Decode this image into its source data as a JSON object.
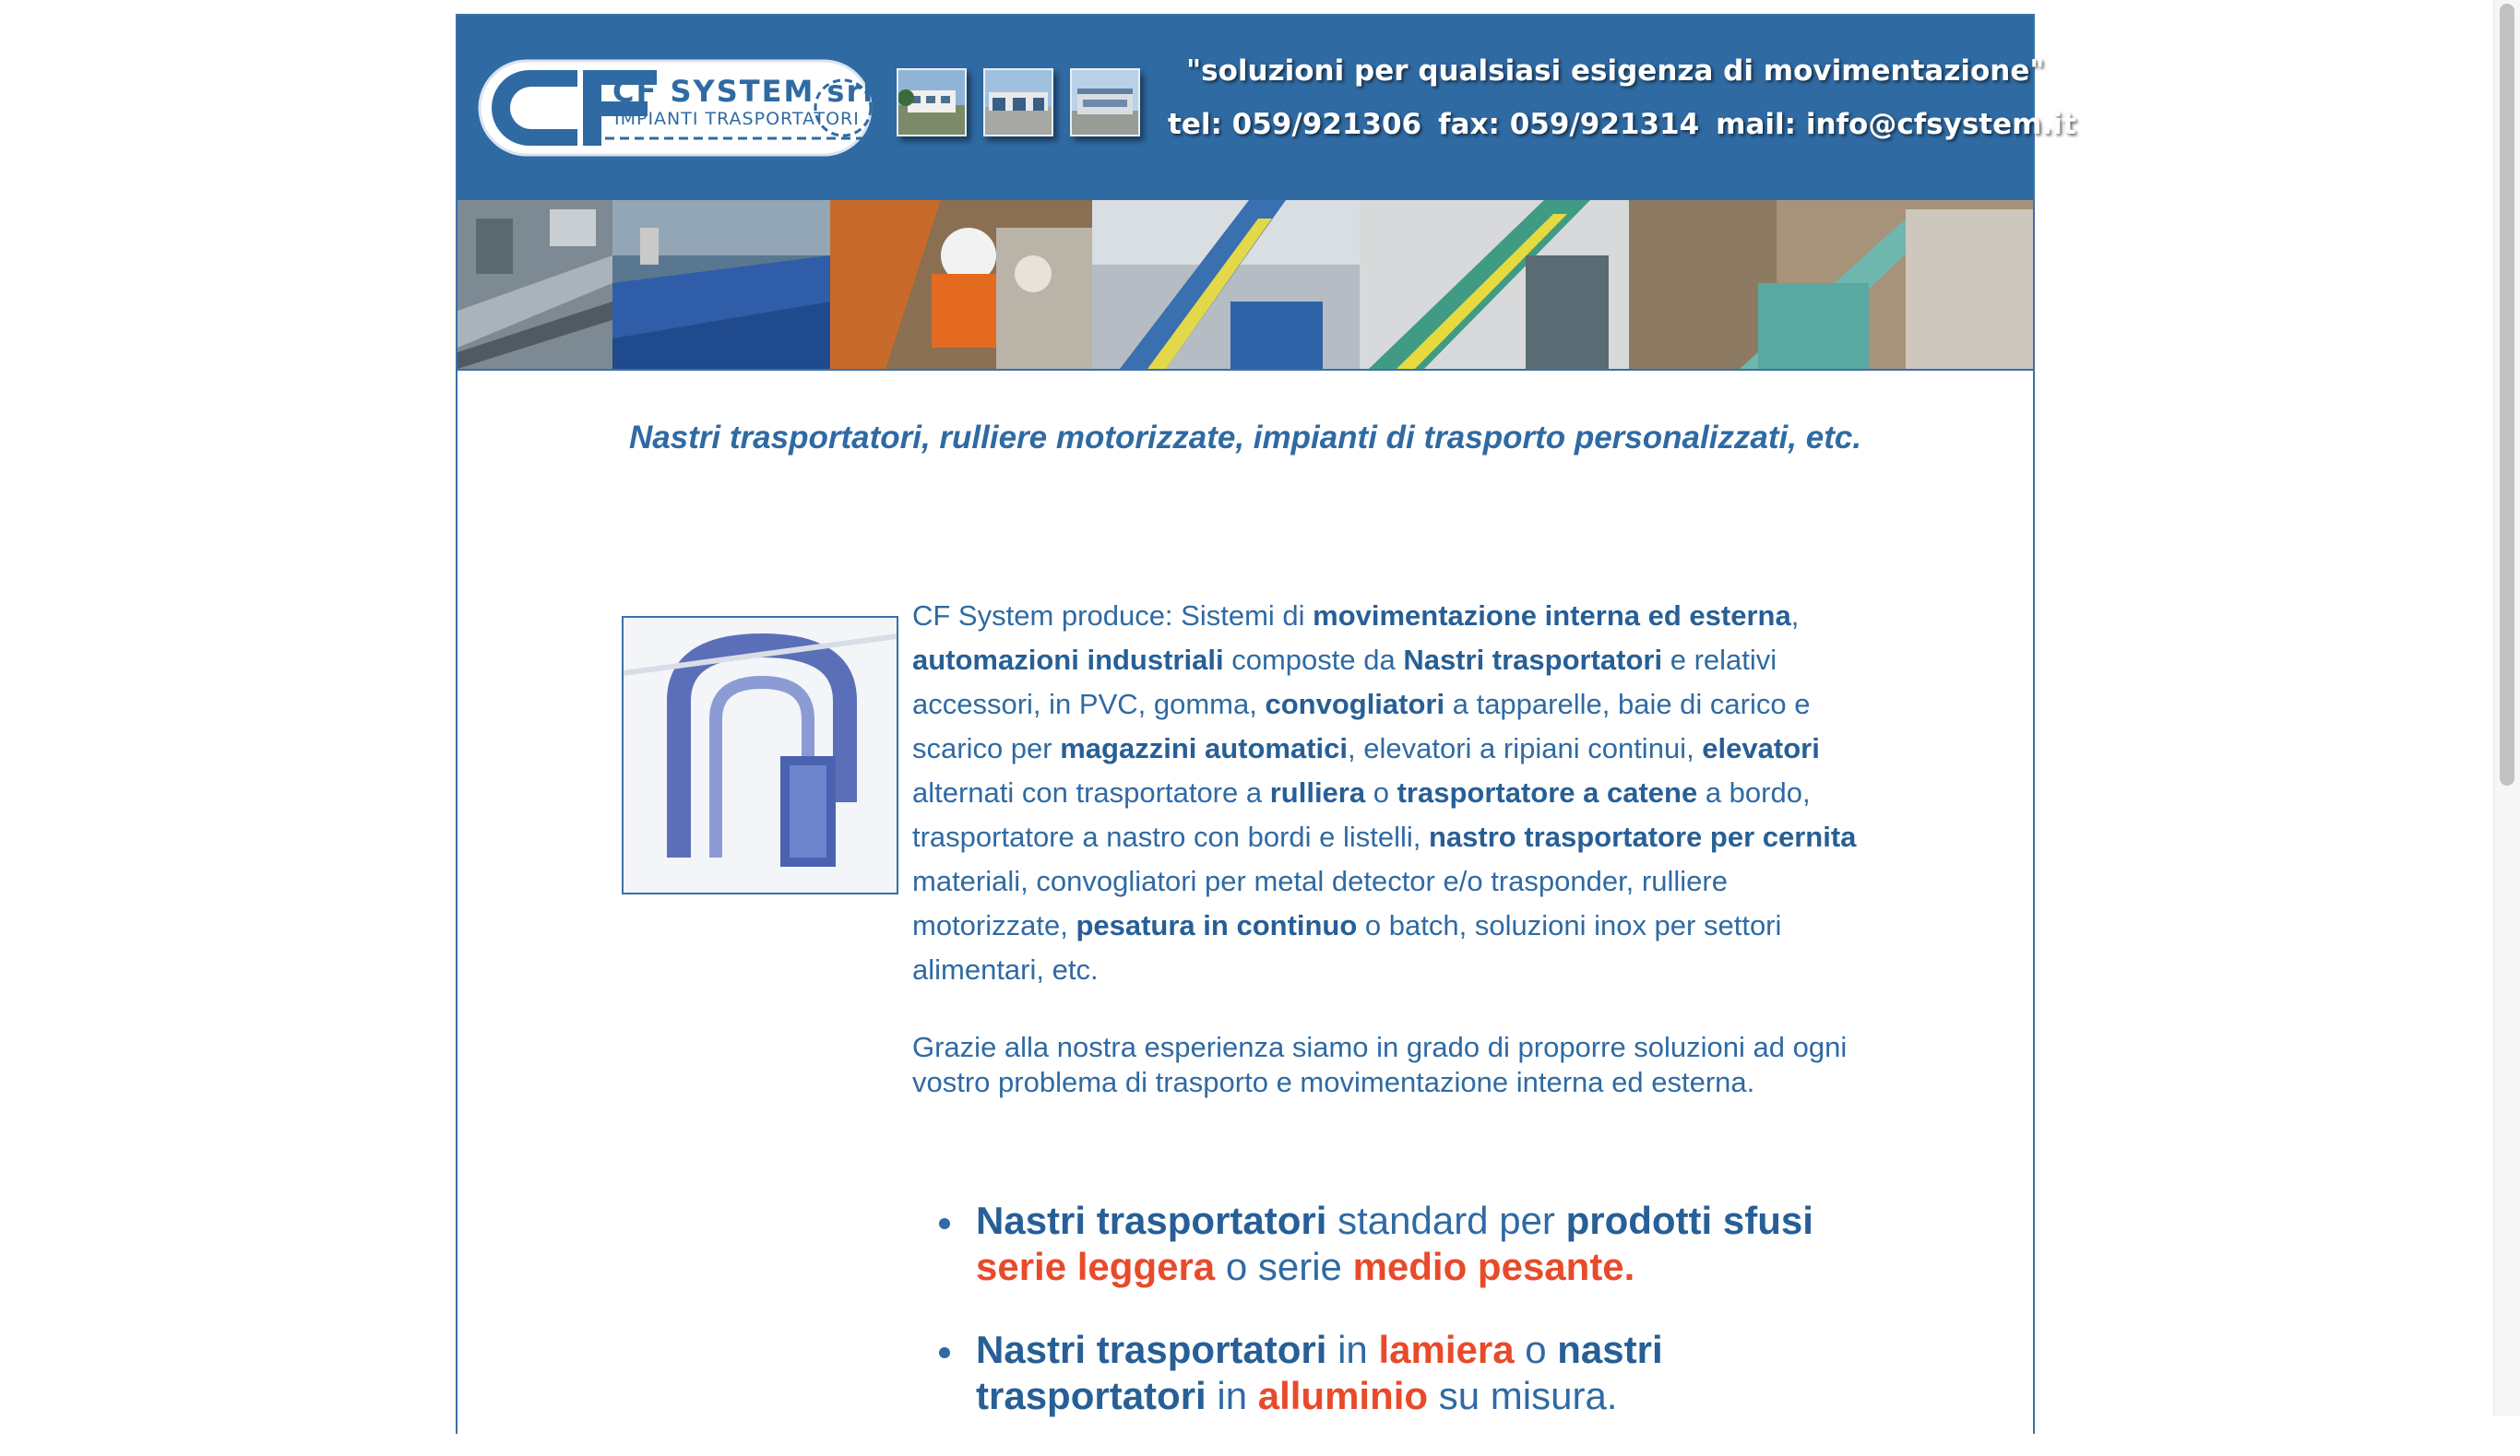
{
  "header": {
    "logo_letters": "CF",
    "logo_name": "CF SYSTEM srl",
    "logo_sub": "IMPIANTI TRASPORTATORI",
    "slogan": "\"soluzioni per qualsiasi esigenza di movimentazione\"",
    "tel": "tel: 059/921306",
    "fax": "fax: 059/921314",
    "mail": "mail: info@cfsystem.it"
  },
  "colors": {
    "brand_blue": "#2f6aa3",
    "accent_red": "#e84a2a"
  },
  "tagline": "Nastri trasportatori, rulliere motorizzate, impianti di trasporto personalizzati, etc.",
  "intro": {
    "t1": "CF System produce:  Sistemi di ",
    "b1": "movimentazione interna ed esterna",
    "t2": ", ",
    "b2": "automazioni industriali",
    "t3": " composte da ",
    "b3": "Nastri trasportatori",
    "t4": " e relativi accessori, in PVC, gomma, ",
    "b4": "convogliatori",
    "t5": " a tapparelle, baie di carico e scarico per ",
    "b5": "magazzini automatici",
    "t6": ", elevatori a ripiani continui, ",
    "b6": "elevatori",
    "t7": " alternati con trasportatore a ",
    "b7": "rulliera",
    "t8": " o ",
    "b8": "trasportatore a catene",
    "t9": " a bordo, trasportatore a nastro con bordi e listelli, ",
    "b9": "nastro trasportatore per cernita",
    "t10": " materiali, convogliatori per metal detector e/o trasponder, rulliere motorizzate, ",
    "b10": "pesatura in continuo",
    "t11": " o batch, soluzioni inox per settori alimentari, etc."
  },
  "intro2": "Grazie alla nostra esperienza siamo in grado di proporre soluzioni ad ogni vostro problema di trasporto e movimentazione interna ed esterna.",
  "bullets": [
    {
      "b1": "Nastri trasportatori",
      "t1": " standard per ",
      "b2": "prodotti sfusi",
      "t2": " ",
      "r1": "serie leggera",
      "t3": " o serie ",
      "r2": "medio pesante",
      "r3": "."
    },
    {
      "b1": "Nastri trasportatori",
      "t1": " in ",
      "r1": "lamiera",
      "t2": " o ",
      "b2": "nastri trasportatori",
      "t3": " in ",
      "r2": "alluminio",
      "t4": " su misura."
    }
  ]
}
